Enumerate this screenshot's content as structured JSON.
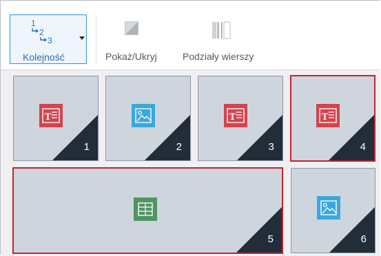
{
  "toolbar": {
    "order_label": "Kolejność",
    "show_hide_label": "Pokaż/Ukryj",
    "row_breaks_label": "Podziały wierszy",
    "order_icon_numbers": [
      "1",
      "2",
      "3"
    ]
  },
  "tiles": [
    {
      "number": "1",
      "type": "text-icon",
      "selected": false
    },
    {
      "number": "2",
      "type": "image-icon",
      "selected": false
    },
    {
      "number": "3",
      "type": "text-icon",
      "selected": false
    },
    {
      "number": "4",
      "type": "text-icon",
      "selected": true
    },
    {
      "number": "5",
      "type": "table-icon",
      "selected": true
    },
    {
      "number": "6",
      "type": "image-icon",
      "selected": false
    }
  ],
  "colors": {
    "accent_blue": "#3a8fd6",
    "selection_red": "#c8202d",
    "text_icon_red": "#d4434d",
    "image_icon_blue": "#3aa8dd",
    "table_icon_green": "#4f9461",
    "corner_dark": "#222d3a",
    "tile_bg": "#cfd5dd"
  }
}
